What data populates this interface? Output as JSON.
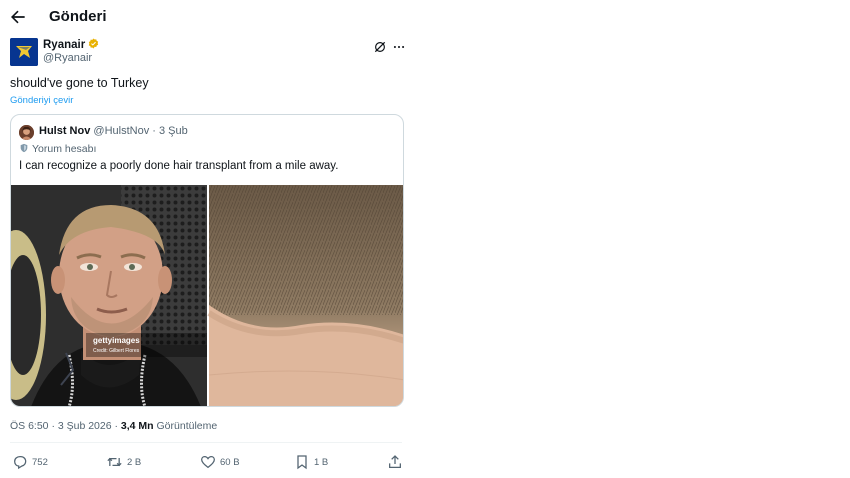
{
  "header": {
    "title": "Gönderi"
  },
  "author": {
    "name": "Ryanair",
    "handle": "@Ryanair",
    "brand_color": "#073590",
    "verified_color": "#e8b100"
  },
  "post": {
    "text": "should've gone to Turkey",
    "translate_label": "Gönderiyi çevir"
  },
  "quote": {
    "name": "Hulst Nov",
    "handle": "@HulstNov",
    "date": "3 Şub",
    "label": "Yorum hesabı",
    "text": "I can recognize a poorly done hair transplant from a mile away.",
    "watermark_main": "gettyimages",
    "watermark_credit": "Credit: Gilbert Flores"
  },
  "meta": {
    "time_date": "ÖS 6:50 · 3 Şub 2026 · ",
    "views": "3,4 Mn",
    "views_label": " Görüntüleme"
  },
  "actions": {
    "reply_count": "752",
    "repost_count": "2 B",
    "like_count": "60 B",
    "bookmark_count": "1 B"
  },
  "colors": {
    "accent": "#1d9bf0",
    "muted": "#536471",
    "text": "#0f1419"
  }
}
